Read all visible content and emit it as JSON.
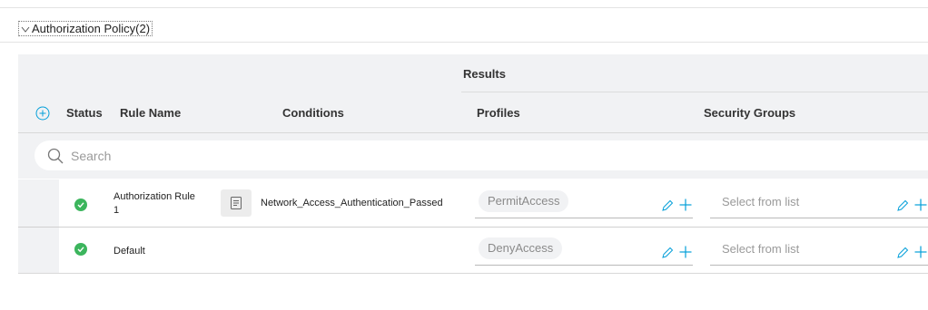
{
  "section": {
    "title": "Authorization Policy(2)"
  },
  "table": {
    "group_header": "Results",
    "columns": {
      "status": "Status",
      "rule_name": "Rule Name",
      "conditions": "Conditions",
      "profiles": "Profiles",
      "security_groups": "Security Groups"
    },
    "search_placeholder": "Search",
    "rows": [
      {
        "status": "enabled",
        "rule_name_line1": "Authorization Rule",
        "rule_name_line2": "1",
        "condition": "Network_Access_Authentication_Passed",
        "profile": "PermitAccess",
        "security_group_placeholder": "Select from list"
      },
      {
        "status": "enabled",
        "rule_name_line1": "Default",
        "rule_name_line2": "",
        "condition": "",
        "profile": "DenyAccess",
        "security_group_placeholder": "Select from list"
      }
    ]
  },
  "colors": {
    "accent": "#049fd9",
    "status_ok": "#3cb55d",
    "header_bg": "#f1f2f4"
  },
  "icons": [
    "chevron-down-icon",
    "add-circle-icon",
    "search-icon",
    "checkmark-icon",
    "condition-document-icon",
    "edit-pencil-icon",
    "plus-icon"
  ]
}
